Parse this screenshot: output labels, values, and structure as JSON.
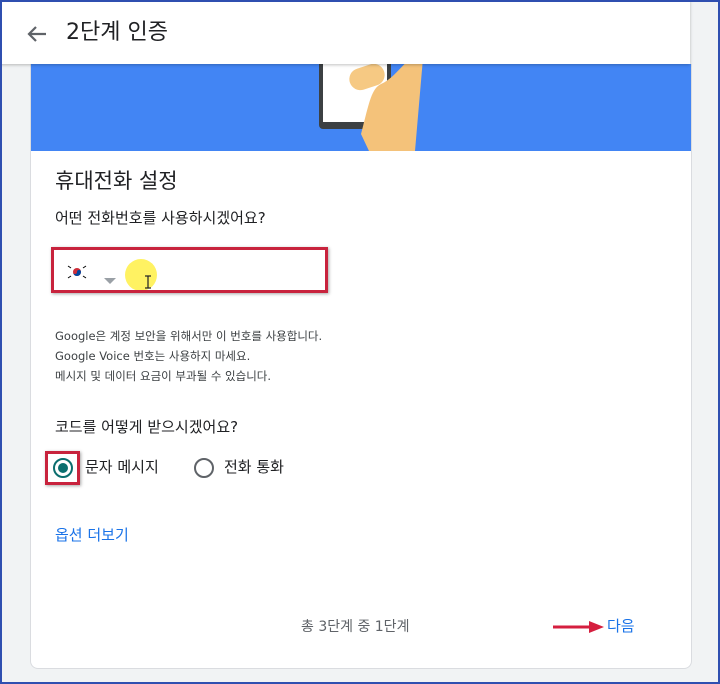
{
  "header": {
    "title": "2단계 인증",
    "back_icon": "arrow-left-icon"
  },
  "banner": {
    "color": "#4285f4",
    "illustration": "hand-holding-phone"
  },
  "section": {
    "title": "휴대전화 설정",
    "phone_question": "어떤 전화번호를 사용하시겠어요?",
    "country_flag": "south-korea-flag",
    "phone_value": "",
    "help_lines": [
      "Google은 계정 보안을 위해서만 이 번호를 사용합니다.",
      "Google Voice 번호는 사용하지 마세요.",
      "메시지 및 데이터 요금이 부과될 수 있습니다."
    ]
  },
  "code_method": {
    "question": "코드를 어떻게 받으시겠어요?",
    "options": [
      {
        "label": "문자 메시지",
        "checked": true
      },
      {
        "label": "전화 통화",
        "checked": false
      }
    ]
  },
  "more_options": "옵션 더보기",
  "footer": {
    "step": "총 3단계 중 1단계",
    "next": "다음"
  },
  "colors": {
    "accent": "#1a73e8",
    "highlight": "#c8233d",
    "radio": "#0b6e6e"
  }
}
